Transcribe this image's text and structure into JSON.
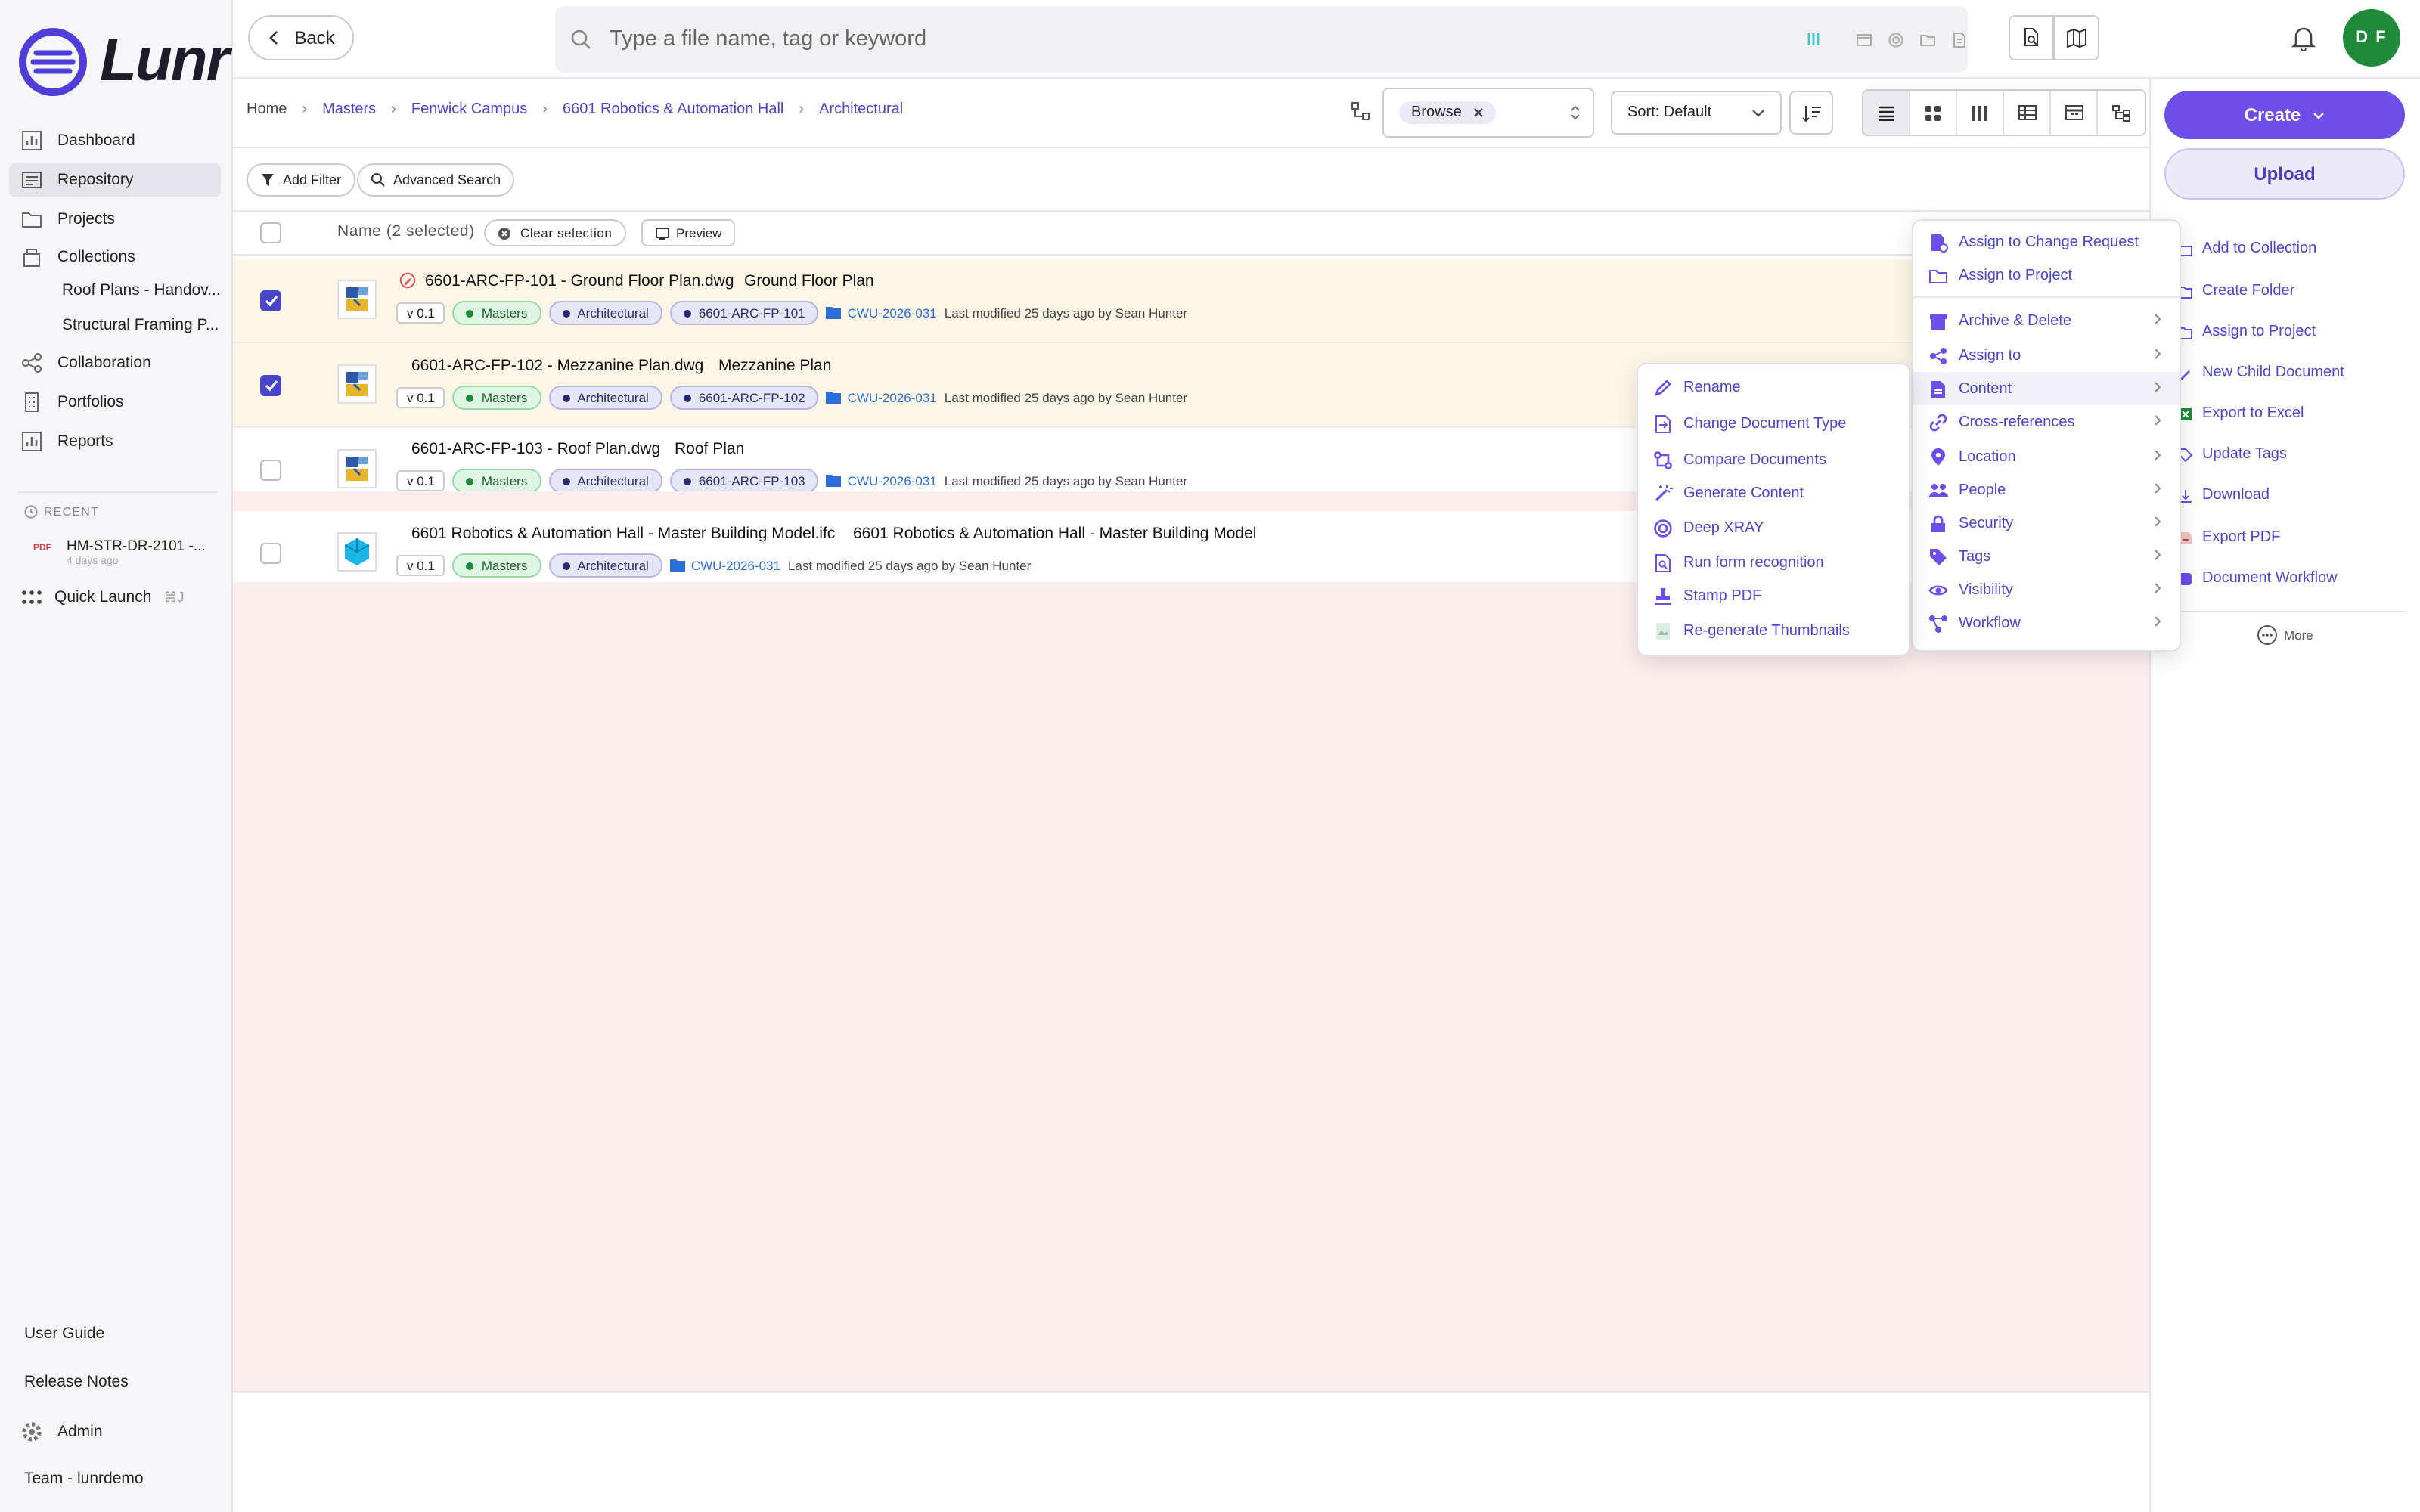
{
  "app": {
    "logo_text": "Lunr",
    "avatar_initials": "D F"
  },
  "sidebar": {
    "items": [
      {
        "label": "Dashboard",
        "icon": "chart-icon"
      },
      {
        "label": "Repository",
        "icon": "repository-icon"
      },
      {
        "label": "Projects",
        "icon": "folder-icon"
      },
      {
        "label": "Collections",
        "icon": "collections-icon"
      },
      {
        "label": "Collaboration",
        "icon": "share-icon"
      },
      {
        "label": "Portfolios",
        "icon": "building-icon"
      },
      {
        "label": "Reports",
        "icon": "chart-icon"
      }
    ],
    "collections": [
      "Roof Plans - Handov...",
      "Structural Framing P..."
    ],
    "recent_heading": "RECENT",
    "recent_item": {
      "badge": "PDF",
      "name": "HM-STR-DR-2101 -...",
      "time": "4 days ago"
    },
    "quick_launch": {
      "label": "Quick Launch",
      "shortcut": "⌘J"
    },
    "bottom": {
      "user_guide": "User Guide",
      "release_notes": "Release Notes",
      "admin": "Admin",
      "team": "Team - lunrdemo"
    }
  },
  "topbar": {
    "back_label": "Back",
    "search_placeholder": "Type a file name, tag or keyword"
  },
  "breadcrumb": [
    "Home",
    "Masters",
    "Fenwick Campus",
    "6601 Robotics & Automation Hall",
    "Architectural"
  ],
  "toolbar": {
    "browse_chip": "Browse",
    "sort_label": "Sort: Default"
  },
  "filters": {
    "add_filter": "Add Filter",
    "advanced_search": "Advanced Search"
  },
  "table": {
    "header_name": "Name (2 selected)",
    "clear_selection": "Clear selection",
    "preview": "Preview",
    "rows": [
      {
        "file": "6601-ARC-FP-101 - Ground Floor Plan.dwg",
        "title": "Ground Floor Plan",
        "version": "v 0.1",
        "tags": [
          "Masters",
          "Architectural",
          "6601-ARC-FP-101"
        ],
        "folder": "CWU-2026-031",
        "modified": "Last modified 25 days ago by Sean Hunter",
        "selected": true
      },
      {
        "file": "6601-ARC-FP-102 - Mezzanine Plan.dwg",
        "title": "Mezzanine Plan",
        "version": "v 0.1",
        "tags": [
          "Masters",
          "Architectural",
          "6601-ARC-FP-102"
        ],
        "folder": "CWU-2026-031",
        "modified": "Last modified 25 days ago by Sean Hunter",
        "selected": true
      },
      {
        "file": "6601-ARC-FP-103 - Roof Plan.dwg",
        "title": "Roof Plan",
        "version": "v 0.1",
        "tags": [
          "Masters",
          "Architectural",
          "6601-ARC-FP-103"
        ],
        "folder": "CWU-2026-031",
        "modified": "Last modified 25 days ago by Sean Hunter",
        "selected": false
      },
      {
        "file": "6601 Robotics & Automation Hall - Master Building Model.ifc",
        "title": "6601 Robotics & Automation Hall - Master Building Model",
        "version": "v 0.1",
        "tags": [
          "Masters",
          "Architectural"
        ],
        "folder": "CWU-2026-031",
        "modified": "Last modified 25 days ago by Sean Hunter",
        "selected": false
      }
    ]
  },
  "right_panel": {
    "create_label": "Create",
    "upload_label": "Upload",
    "actions": [
      "Add to Collection",
      "Create Folder",
      "Assign to Project",
      "New Child Document",
      "Export to Excel",
      "Update Tags",
      "Download",
      "Export PDF",
      "Document Workflow"
    ],
    "more_label": "More"
  },
  "context_menu": {
    "top": [
      "Assign to Change Request",
      "Assign to Project"
    ],
    "items": [
      "Archive & Delete",
      "Assign to",
      "Content",
      "Cross-references",
      "Location",
      "People",
      "Security",
      "Tags",
      "Visibility",
      "Workflow"
    ]
  },
  "content_submenu": [
    "Rename",
    "Change Document Type",
    "Compare Documents",
    "Generate Content",
    "Deep XRAY",
    "Run form recognition",
    "Stamp PDF",
    "Re-generate Thumbnails"
  ],
  "colors": {
    "accent": "#6d4ee6",
    "link": "#4a46c8",
    "selected_row": "#fdf5e6",
    "avatar": "#1e8a3a"
  }
}
